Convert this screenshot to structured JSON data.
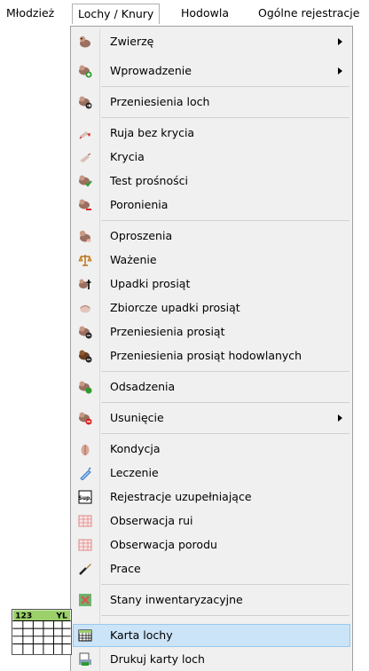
{
  "menubar": {
    "items": [
      {
        "label": "Młodzież"
      },
      {
        "label": "Lochy / Knury"
      },
      {
        "label": "Hodowla"
      },
      {
        "label": "Ogólne rejestracje"
      }
    ]
  },
  "menu": {
    "items": [
      {
        "label": "Zwierzę",
        "icon": "sow-icon"
      },
      {
        "label": "Wprowadzenie",
        "icon": "sow-add-icon"
      },
      {
        "label": "Przeniesienia loch",
        "icon": "sow-transfer-icon"
      },
      {
        "label": "Ruja bez krycia",
        "icon": "heat-icon"
      },
      {
        "label": "Krycia",
        "icon": "insemination-icon"
      },
      {
        "label": "Test prośności",
        "icon": "pregnancy-test-icon"
      },
      {
        "label": "Poronienia",
        "icon": "abortion-icon"
      },
      {
        "label": "Oproszenia",
        "icon": "farrowing-icon"
      },
      {
        "label": "Ważenie",
        "icon": "scale-icon"
      },
      {
        "label": "Upadki prosiąt",
        "icon": "piglet-death-icon"
      },
      {
        "label": "Zbiorcze upadki prosiąt",
        "icon": "collective-death-icon"
      },
      {
        "label": "Przeniesienia prosiąt",
        "icon": "piglet-transfer-icon"
      },
      {
        "label": "Przeniesienia prosiąt hodowlanych",
        "icon": "breeding-piglet-transfer-icon"
      },
      {
        "label": "Odsadzenia",
        "icon": "weaning-icon"
      },
      {
        "label": "Usunięcie",
        "icon": "removal-icon"
      },
      {
        "label": "Kondycja",
        "icon": "condition-icon"
      },
      {
        "label": "Leczenie",
        "icon": "treatment-icon"
      },
      {
        "label": "Rejestracje uzupełniające",
        "icon": "supplementary-icon"
      },
      {
        "label": "Obserwacja rui",
        "icon": "heat-observation-icon"
      },
      {
        "label": "Obserwacja porodu",
        "icon": "farrowing-observation-icon"
      },
      {
        "label": "Prace",
        "icon": "work-icon"
      },
      {
        "label": "Stany inwentaryzacyjne",
        "icon": "inventory-icon"
      },
      {
        "label": "Karta lochy",
        "icon": "sow-card-icon"
      },
      {
        "label": "Drukuj karty loch",
        "icon": "print-cards-icon"
      }
    ]
  },
  "preview": {
    "left_text": "123",
    "right_text": "YL"
  },
  "colors": {
    "highlight": "#cce4f7",
    "highlight_border": "#99c9ef",
    "menu_bg": "#f0f0f0"
  }
}
